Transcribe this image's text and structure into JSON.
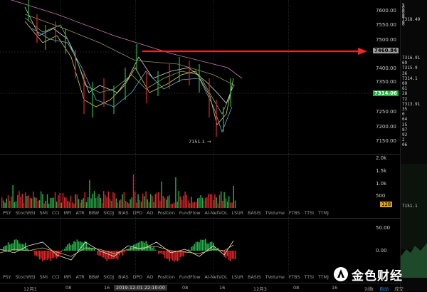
{
  "price_axis": [
    "7600.00",
    "7550.00",
    "7500.00",
    "7450.00",
    "7400.00",
    "7350.00",
    "7300.00",
    "7250.00",
    "7200.00",
    "7150.00"
  ],
  "current_price": "7314.06",
  "annotated_price": "7460.84",
  "low_marker": "7151.1",
  "volume_axis": [
    "2.0k",
    "1.5k",
    "1.0k",
    "500"
  ],
  "volume_badge": "128",
  "osc_axis": [
    "50.00",
    "0.00"
  ],
  "indicator_tabs": [
    "PSY",
    "StochRSI",
    "SMI",
    "CCI",
    "MFI",
    "ATR",
    "BBW",
    "SKDJ",
    "BIAS",
    "DPO",
    "AO",
    "Position",
    "FundFlow",
    "AI-NetVOL",
    "LSUR",
    "BASIS",
    "TVolume",
    "FTBS",
    "TTSI",
    "TTMJ"
  ],
  "time_labels": [
    "12月1",
    "08",
    "16",
    "2019-12-01 22:10:00",
    "08",
    "16",
    "12月3",
    "08",
    "16"
  ],
  "right_panel": {
    "top_values": [
      "5",
      "0",
      "0",
      "0",
      "0",
      "0",
      "7318.49",
      "0",
      "0"
    ],
    "mid_values": [
      "7316.91",
      "69",
      "7315.9",
      "36",
      "7314.1",
      "09",
      "61",
      "28",
      "72",
      "7313.91",
      "35",
      "0",
      "64",
      "25",
      "87",
      "92",
      "2",
      "06"
    ],
    "low_value": "7151.1"
  },
  "watermark": "金色财经",
  "footer_tabs": [
    "对数",
    "自动",
    "成交"
  ],
  "colors": {
    "up": "#23b34a",
    "down": "#e0262a",
    "arrow": "#e8282b",
    "price_tag": "#1fae3a"
  }
}
